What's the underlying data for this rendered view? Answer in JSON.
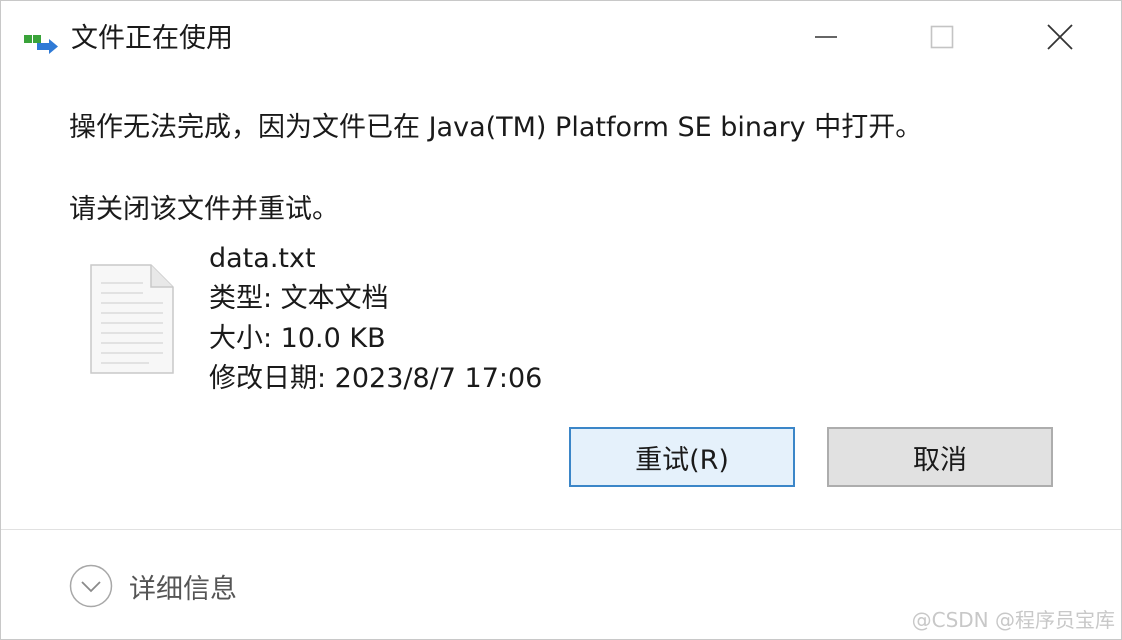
{
  "window": {
    "title": "文件正在使用",
    "app_icon": "file-transfer-icon",
    "controls": [
      "minimize-icon",
      "maximize-icon",
      "close-icon"
    ]
  },
  "message": {
    "line1": "操作无法完成，因为文件已在 Java(TM) Platform SE binary 中打开。",
    "line2": "请关闭该文件并重试。"
  },
  "file": {
    "icon": "text-document-icon",
    "name": "data.txt",
    "type_row": "类型: 文本文档",
    "size_row": "大小: 10.0 KB",
    "modified_row": "修改日期: 2023/8/7 17:06"
  },
  "buttons": {
    "retry_label": "重试(R)",
    "cancel_label": "取消"
  },
  "footer": {
    "details_label": "详细信息",
    "details_icon": "chevron-down-icon",
    "watermark": "@CSDN @程序员宝库"
  },
  "colors": {
    "retry_bg": "#e5f1fb",
    "retry_border": "#3b86c8",
    "cancel_bg": "#e1e1e1",
    "cancel_border": "#adadad"
  }
}
